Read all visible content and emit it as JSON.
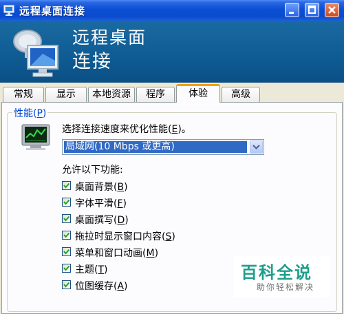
{
  "window": {
    "title": "远程桌面连接",
    "icon": "remote-desktop-icon",
    "controls": [
      "minimize",
      "maximize",
      "close"
    ]
  },
  "banner": {
    "line1": "远程桌面",
    "line2": "连接"
  },
  "tabs": [
    {
      "label": "常规"
    },
    {
      "label": "显示"
    },
    {
      "label": "本地资源"
    },
    {
      "label": "程序"
    },
    {
      "label": "体验",
      "active": true
    },
    {
      "label": "高级"
    }
  ],
  "performance": {
    "group_title": "性能",
    "group_key": "P",
    "speed_label": "选择连接速度来优化性能",
    "speed_key": "E",
    "speed_value": "局域网(10 Mbps 或更高)",
    "allow_label": "允许以下功能:",
    "options": [
      {
        "label": "桌面背景",
        "key": "B",
        "checked": true
      },
      {
        "label": "字体平滑",
        "key": "F",
        "checked": true
      },
      {
        "label": "桌面撰写",
        "key": "D",
        "checked": true
      },
      {
        "label": "拖拉时显示窗口内容",
        "key": "S",
        "checked": true
      },
      {
        "label": "菜单和窗口动画",
        "key": "M",
        "checked": true
      },
      {
        "label": "主题",
        "key": "T",
        "checked": true
      },
      {
        "label": "位图缓存",
        "key": "A",
        "checked": true
      }
    ]
  },
  "watermark": {
    "main": "百科全说",
    "sub": "助你轻松解决"
  },
  "colors": {
    "title_bar": "#0b4fd6",
    "banner": "#1a6aa2",
    "active_tab_accent": "#f1a20f",
    "selection": "#316ac5",
    "check": "#21a121",
    "group_title": "#0046d5",
    "watermark": "#1e9e8a"
  }
}
